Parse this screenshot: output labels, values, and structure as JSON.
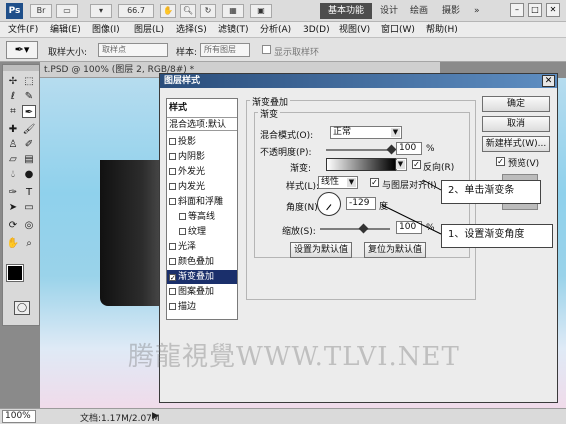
{
  "titlebar": {
    "logo": "Ps",
    "zoom": "66.7",
    "workspaces": [
      "基本功能",
      "设计",
      "绘画",
      "摄影"
    ],
    "more": "»",
    "controls": [
      "–",
      "□",
      "✕"
    ]
  },
  "menu": [
    "文件(F)",
    "编辑(E)",
    "图像(I)",
    "图层(L)",
    "选择(S)",
    "滤镜(T)",
    "分析(A)",
    "3D(D)",
    "视图(V)",
    "窗口(W)",
    "帮助(H)"
  ],
  "options": {
    "sample_size_label": "取样大小:",
    "sample_size_value": "取样点",
    "sample_label": "样本:",
    "sample_value": "所有图层",
    "show_ring_label": "显示取样环"
  },
  "document": {
    "tab_title": "t.PSD @ 100% (图层 2, RGB/8#) *",
    "zoom": "100%",
    "doc_info": "文档:1.17M/2.07M"
  },
  "dialog": {
    "title": "图层样式",
    "close": "✕",
    "styles_header": "样式",
    "blend_default": "混合选项:默认",
    "style_items": [
      {
        "label": "投影",
        "checked": false
      },
      {
        "label": "内阴影",
        "checked": false
      },
      {
        "label": "外发光",
        "checked": false
      },
      {
        "label": "内发光",
        "checked": false
      },
      {
        "label": "斜面和浮雕",
        "checked": false
      },
      {
        "label": "等高线",
        "checked": false
      },
      {
        "label": "纹理",
        "checked": false
      },
      {
        "label": "光泽",
        "checked": false
      },
      {
        "label": "颜色叠加",
        "checked": false
      },
      {
        "label": "渐变叠加",
        "checked": true
      },
      {
        "label": "图案叠加",
        "checked": false
      },
      {
        "label": "描边",
        "checked": false
      }
    ],
    "section_title": "渐变叠加",
    "subsection_title": "渐变",
    "blend_mode_label": "混合模式(O):",
    "blend_mode_value": "正常",
    "opacity_label": "不透明度(P):",
    "opacity_value": "100",
    "gradient_label": "渐变:",
    "reverse_label": "反向(R)",
    "style_label": "样式(L):",
    "style_value": "线性",
    "align_label": "与图层对齐(I)",
    "angle_label": "角度(N):",
    "angle_value": "-129",
    "degree_unit": "度",
    "scale_label": "缩放(S):",
    "scale_value": "100",
    "percent": "%",
    "make_default": "设置为默认值",
    "reset_default": "复位为默认值",
    "ok": "确定",
    "cancel": "取消",
    "new_style": "新建样式(W)...",
    "preview_label": "预览(V)"
  },
  "annotations": {
    "step1": "1、设置渐变角度",
    "step2": "2、单击渐变条"
  },
  "watermark": "腾龍視覺WWW.TLVI.NET"
}
